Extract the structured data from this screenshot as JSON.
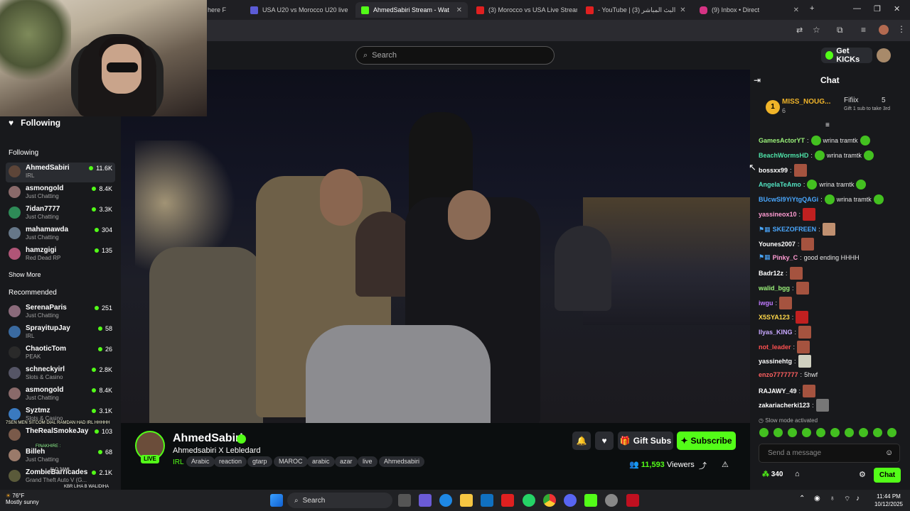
{
  "browser": {
    "tabs": [
      {
        "title": "here F",
        "active": false
      },
      {
        "title": "USA U20 vs Morocco U20 live",
        "active": false
      },
      {
        "title": "AhmedSabiri Stream - Wat",
        "active": true
      },
      {
        "title": "(3) Morocco vs USA Live Stream",
        "active": false
      },
      {
        "title": "- YouTube | البث المباشر (3)",
        "active": false
      },
      {
        "title": "(9) Inbox • Direct",
        "active": false
      }
    ],
    "new_tab": "+"
  },
  "kick": {
    "search_placeholder": "Search",
    "get_kicks": "Get KICKs"
  },
  "sidebar": {
    "following_header": "Following",
    "following_label": "Following",
    "following": [
      {
        "name": "AhmedSabiri",
        "category": "IRL",
        "viewers": "11.6K"
      },
      {
        "name": "asmongold",
        "category": "Just Chatting",
        "viewers": "8.4K"
      },
      {
        "name": "7idan7777",
        "category": "Just Chatting",
        "viewers": "3.3K"
      },
      {
        "name": "mahamawda",
        "category": "Just Chatting",
        "viewers": "304"
      },
      {
        "name": "hamzgigi",
        "category": "Red Dead RP",
        "viewers": "135"
      }
    ],
    "show_more": "Show More",
    "recommended_label": "Recommended",
    "recommended": [
      {
        "name": "SerenaParis",
        "category": "Just Chatting",
        "viewers": "251"
      },
      {
        "name": "SprayitupJay",
        "category": "IRL",
        "viewers": "58"
      },
      {
        "name": "ChaoticTom",
        "category": "PEAK",
        "viewers": "26"
      },
      {
        "name": "schneckyirl",
        "category": "Slots & Casino",
        "viewers": "2.8K"
      },
      {
        "name": "asmongold",
        "category": "Just Chatting",
        "viewers": "8.4K"
      },
      {
        "name": "Syztmz",
        "category": "Slots & Casino",
        "viewers": "3.1K"
      },
      {
        "name": "TheRealSmokeJay",
        "category": "",
        "viewers": "103"
      },
      {
        "name": "Billeh",
        "category": "Just Chatting",
        "viewers": "68"
      },
      {
        "name": "ZombieBarricades",
        "category": "Grand Theft Auto V (G...",
        "viewers": "2.1K"
      }
    ]
  },
  "stream_overlay": [
    "7SEN MEN SITCOM DIAL RAMDAN HAD IRL HHHHH",
    "FINAKHIRE :",
    "ALO 3AMI",
    "KBR LIHA B WALIDIHA"
  ],
  "stream": {
    "streamer": "AhmedSabiri",
    "title": "Ahmedsabiri X Lebledard",
    "category": "IRL",
    "live": "LIVE",
    "tags": [
      "Arabic",
      "reaction",
      "gtarp",
      "MAROC",
      "arabic",
      "azar",
      "live",
      "Ahmedsabiri"
    ],
    "gift_subs": "Gift Subs",
    "subscribe": "Subscribe",
    "viewers_count": "11,593",
    "viewers_label": "Viewers"
  },
  "chat": {
    "title": "Chat",
    "pinned": {
      "user": "MISS_NOUG...",
      "user_count": "6",
      "gifter": "Fifiix",
      "gift_count": "5",
      "gift_text": "Gift 1 sub to take 3rd"
    },
    "messages": [
      {
        "user": "GamesActorYT",
        "color": "#9bf27a",
        "text": "wrina tramtk"
      },
      {
        "user": "BeachWormsHD",
        "color": "#4ee3a8",
        "text": "wrina tramtk"
      },
      {
        "user": "bossxx99",
        "color": "#ffffff",
        "text": ""
      },
      {
        "user": "AngelaTeAmo",
        "color": "#52e3c2",
        "text": "wrina tramtk"
      },
      {
        "user": "BUcwSl9YiYtgQAGi",
        "color": "#4aa8ff",
        "text": "wrina tramtk"
      },
      {
        "user": "yassineox10",
        "color": "#ff9bd2",
        "text": ""
      },
      {
        "user": "SKEZOFREEN",
        "color": "#4aa8ff",
        "text": ""
      },
      {
        "user": "Younes2007",
        "color": "#ffffff",
        "text": ""
      },
      {
        "user": "Pinky_C",
        "color": "#ff9bd2",
        "text": "good ending HHHH"
      },
      {
        "user": "Badr12z",
        "color": "#ffffff",
        "text": ""
      },
      {
        "user": "walid_bgg",
        "color": "#9bf27a",
        "text": ""
      },
      {
        "user": "iwgu",
        "color": "#c07aff",
        "text": ""
      },
      {
        "user": "X5SYA123",
        "color": "#ffd84a",
        "text": ""
      },
      {
        "user": "Ilyas_KING",
        "color": "#c8a8ff",
        "text": ""
      },
      {
        "user": "not_leader",
        "color": "#ff5050",
        "text": ""
      },
      {
        "user": "yassinehtg",
        "color": "#ffffff",
        "text": ""
      },
      {
        "user": "enzo7777777",
        "color": "#ff6060",
        "text": "5hwf"
      },
      {
        "user": "RAJAWY_49",
        "color": "#ffffff",
        "text": ""
      },
      {
        "user": "zakariacherki123",
        "color": "#ffffff",
        "text": ""
      }
    ],
    "slow_mode": "Slow mode activated",
    "send_placeholder": "Send a message",
    "points": "340",
    "chat_button": "Chat"
  },
  "taskbar": {
    "search": "Search",
    "weather_temp": "76°F",
    "weather_desc": "Mostly sunny",
    "time": "11:44 PM",
    "date": "10/12/2025"
  },
  "colors": {
    "accent": "#53fc18",
    "bg": "#0b0e0f",
    "panel": "#18191c"
  }
}
